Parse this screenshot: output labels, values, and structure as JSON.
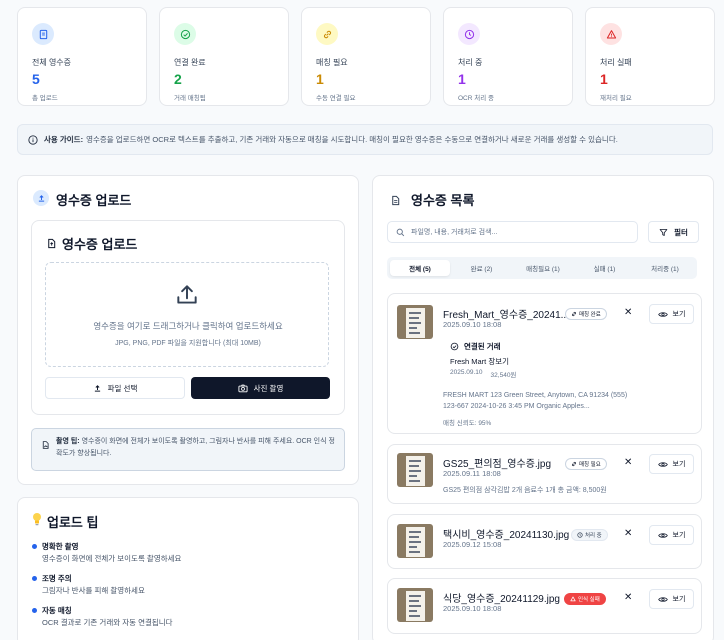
{
  "stats": [
    {
      "label": "전체 영수증",
      "value": "5",
      "sub": "총 업로드",
      "color": "#2563eb",
      "bg": "#dbeafe",
      "icon": "receipt-icon"
    },
    {
      "label": "연결 완료",
      "value": "2",
      "sub": "거래 매칭됨",
      "color": "#16a34a",
      "bg": "#dcfce7",
      "icon": "check-circle-icon"
    },
    {
      "label": "매칭 필요",
      "value": "1",
      "sub": "수동 연결 필요",
      "color": "#ca8a04",
      "bg": "#fef9c3",
      "icon": "link-icon"
    },
    {
      "label": "처리 중",
      "value": "1",
      "sub": "OCR 처리 중",
      "color": "#9333ea",
      "bg": "#f3e8ff",
      "icon": "clock-icon"
    },
    {
      "label": "처리 실패",
      "value": "1",
      "sub": "재처리 필요",
      "color": "#dc2626",
      "bg": "#fee2e2",
      "icon": "warning-icon"
    }
  ],
  "guide": {
    "title": "사용 가이드:",
    "text": "영수증을 업로드하면 OCR로 텍스트를 추출하고, 기존 거래와 자동으로 매칭을 시도합니다. 매칭이 필요한 영수증은 수동으로 연결하거나 새로운 거래를 생성할 수 있습니다."
  },
  "upload": {
    "section_title": "영수증 업로드",
    "inner_title": "영수증 업로드",
    "drop_text": "영수증을 여기로 드래그하거나 클릭하여 업로드하세요",
    "drop_hint": "JPG, PNG, PDF 파일을 지원합니다 (최대 10MB)",
    "select_button": "파일 선택",
    "camera_button": "사진 촬영",
    "tip_title": "촬영 팁:",
    "tip_text": "영수증이 화면에 전체가 보이도록 촬영하고, 그림자나 반사를 피해 주세요. OCR 인식 정확도가 향상됩니다."
  },
  "tips": {
    "title": "업로드 팁",
    "items": [
      {
        "title": "명확한 촬영",
        "desc": "영수증이 화면에 전체가 보이도록 촬영하세요"
      },
      {
        "title": "조명 주의",
        "desc": "그림자나 반사를 피해 촬영하세요"
      },
      {
        "title": "자동 매칭",
        "desc": "OCR 결과로 기존 거래와 자동 연결됩니다"
      }
    ]
  },
  "list": {
    "title": "영수증 목록",
    "search_placeholder": "파일명, 내용, 거래처로 검색...",
    "filter_button": "필터",
    "tabs": [
      "전체 (5)",
      "완료 (2)",
      "매칭필요 (1)",
      "실패 (1)",
      "처리중 (1)"
    ],
    "view_label": "보기",
    "items": [
      {
        "name": "Fresh_Mart_영수증_20241...",
        "date": "2025.09.10 18:08",
        "badge": "매칭 완료",
        "linked_title": "연결된 거래",
        "linked_name": "Fresh Mart 장보기",
        "linked_date": "2025.09.10",
        "linked_amount": "32,540원",
        "ocr_text": "FRESH MART 123 Green Street, Anytown, CA 91234 (555) 123-667 2024-10-26 3:45 PM Organic Apples...",
        "confidence": "매칭 신뢰도: 95%"
      },
      {
        "name": "GS25_편의점_영수증.jpg",
        "date": "2025.09.11 18:08",
        "badge": "매칭 필요",
        "ocr_text": "GS25 편의점 삼각김밥 2개 음료수 1개 총 금액: 8,500원"
      },
      {
        "name": "택시비_영수증_20241130.jpg",
        "date": "2025.09.12 15:08",
        "badge": "처리 중"
      },
      {
        "name": "식당_영수증_20241129.jpg",
        "date": "2025.09.10 18:08",
        "badge": "인식 실패"
      }
    ]
  }
}
